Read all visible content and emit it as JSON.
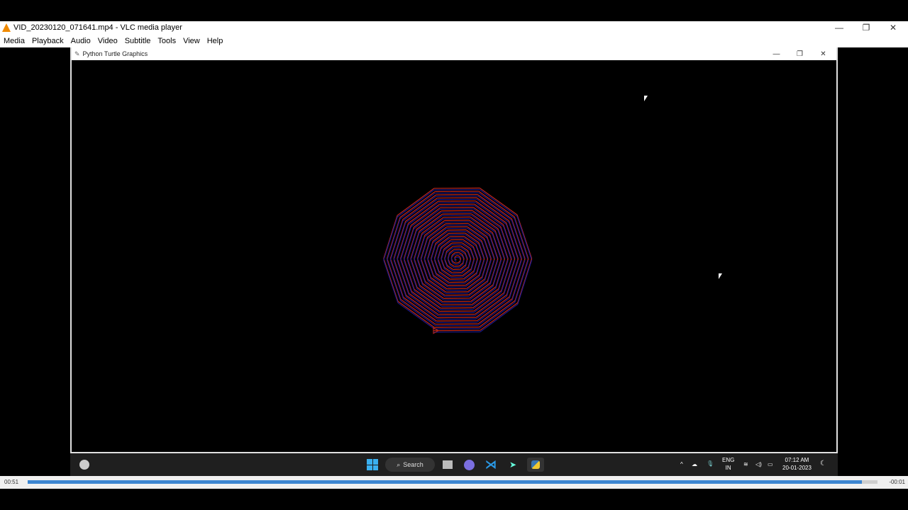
{
  "vlc": {
    "title": "VID_20230120_071641.mp4 - VLC media player",
    "menu": [
      "Media",
      "Playback",
      "Audio",
      "Video",
      "Subtitle",
      "Tools",
      "View",
      "Help"
    ],
    "elapsed": "00:51",
    "remaining": "-00:01",
    "progress_percent": 98.2
  },
  "turtle": {
    "title": "Python Turtle Graphics",
    "pen_colors": [
      "#c0281c",
      "#1a1a8c"
    ],
    "sides": 10
  },
  "taskbar": {
    "search_label": "Search",
    "lang_top": "ENG",
    "lang_bottom": "IN",
    "time": "07:12 AM",
    "date": "20-01-2023"
  },
  "colors": {
    "accent": "#3b85d0",
    "taskbar": "#1f1f1f"
  }
}
